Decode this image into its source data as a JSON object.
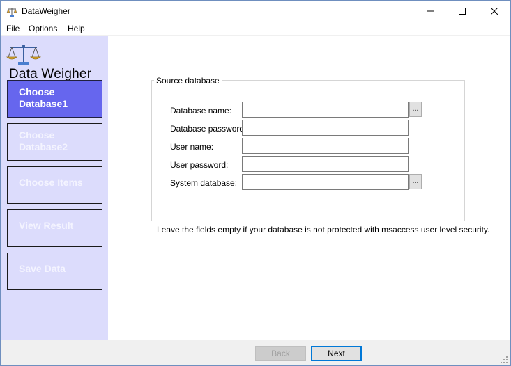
{
  "window": {
    "title": "DataWeigher",
    "app_icon": "balance-scale-icon"
  },
  "menu": {
    "file": "File",
    "options": "Options",
    "help": "Help"
  },
  "sidebar": {
    "logo_text": "Data Weigher",
    "items": [
      {
        "label_line1": "Choose",
        "label_line2": "Database1",
        "state": "active"
      },
      {
        "label_line1": "Choose",
        "label_line2": "Database2",
        "state": "disabled"
      },
      {
        "label_line1": "Choose Items",
        "label_line2": "",
        "state": "disabled"
      },
      {
        "label_line1": "View Result",
        "label_line2": "",
        "state": "disabled"
      },
      {
        "label_line1": "Save Data",
        "label_line2": "",
        "state": "disabled"
      }
    ]
  },
  "source_database": {
    "legend": "Source database",
    "fields": [
      {
        "label": "Database name:",
        "value": "",
        "has_browse": true
      },
      {
        "label": "Database password:",
        "value": "",
        "has_browse": false
      },
      {
        "label": "User name:",
        "value": "",
        "has_browse": false
      },
      {
        "label": "User password:",
        "value": "",
        "has_browse": false
      },
      {
        "label": "System database:",
        "value": "",
        "has_browse": true
      }
    ],
    "browse_label": "..."
  },
  "hint": "Leave the fields empty if your database is not protected with msaccess user level security.",
  "footer": {
    "back_label": "Back",
    "next_label": "Next"
  },
  "colors": {
    "sidebar_bg": "#dcdcfc",
    "active_button": "#6666ee",
    "accent": "#0078d7"
  }
}
